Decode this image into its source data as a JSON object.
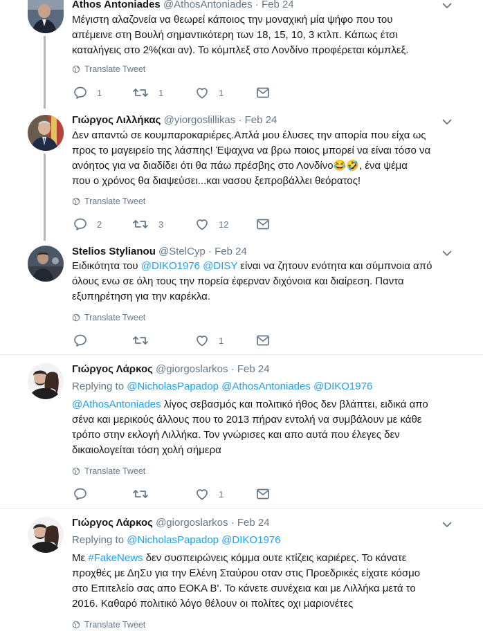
{
  "tweets": [
    {
      "name": "Athos Antoniades",
      "handle": "@AthosAntoniades",
      "date": "Feb 24",
      "text_lines": [
        "Μέγιστη αλαζονεία να θεωρεί κάποιος την μοναχική μία ψήφο που του",
        "απέμεινε στη Βουλή σημαντικότερη των 18, 15, 10, 3 κτλπ. Κάπως έτσι",
        "καταλήγεις στο 2%(και αν). Το κόμπλεξ στο Λονδίνο προφέρεται κόμπλεξ."
      ],
      "translate": "Translate Tweet",
      "replies": "1",
      "retweets": "1",
      "likes": "1"
    },
    {
      "name": "Γιώργος Λιλλήκας",
      "handle": "@yiorgoslillikas",
      "date": "Feb 24",
      "text_lines": [
        "Δεν απαντώ σε κουμπαροκαριέρες.Απλά μου έλυσες την απορία που είχα ως",
        "προς το μαγειρείο της λάσπης! Έψαχνα να βρω ποιος μπορεί να είναι τόσο να",
        "ανόητος για να διαδίδει ότι θα πάω πρέσβης στο Λονδίνο😂🤣, ένα ψέμα",
        "που ο χρόνος θα διαψεύσει...και νασου ξεπροβάλλει θεόρατος!"
      ],
      "translate": "Translate Tweet",
      "replies": "2",
      "retweets": "3",
      "likes": "12"
    },
    {
      "name": "Stelios Stylianou",
      "handle": "@StelCyp",
      "date": "Feb 24",
      "line1_pre": "Ειδικότητα του ",
      "mention1": "@DIKO1976",
      "mention2": "@DISY",
      "line1_post": " είναι να ζητουν ενότητα και σύμπνοια από",
      "line2": "όλους ενω σε όλη τους την πορεία έφερναν διχόνοια και διαίρεση. Παντα",
      "line3": "εξυπηρέτηση για την καρέκλα.",
      "translate": "Translate Tweet",
      "likes": "1"
    },
    {
      "name": "Γιώργος Λάρκος",
      "handle": "@giorgoslarkos",
      "date": "Feb 24",
      "replying_label": "Replying to",
      "replying_mentions": [
        "@NicholasPapadop",
        "@AthosAntoniades",
        "@DIKO1976"
      ],
      "mention": "@AthosAntoniades",
      "line1_post": " λίγος σεβασμός και πολιτικό ήθος δεν βλάπτει, ειδικά απο",
      "line2": "σένα και μερικούς άλλους που το 2013 πήραν εντολή να συμβάλουν με κάθε",
      "line3": "τρόπο στην εκλογή Λιλλήκα. Τον γνώρισες και απο αυτά που έλεγες δεν",
      "line4": "δικαιολογείται τόση χολή σήμερα",
      "translate": "Translate Tweet",
      "likes": "1"
    },
    {
      "name": "Γιώργος Λάρκος",
      "handle": "@giorgoslarkos",
      "date": "Feb 24",
      "replying_label": "Replying to",
      "replying_mentions": [
        "@NicholasPapadop",
        "@DIKO1976"
      ],
      "line1_pre": "Με ",
      "hashtag": "#FakeNews",
      "line1_post": " δεν συσπειρώνεις κόμμα ουτε κτίζεις καριέρες. Το κάνατε",
      "line2": "προχθές με ΔηΣυ για την Ελένη Σταύρου οταν στις Προεδρικές είχατε κόσμο",
      "line3": "στο Επιτελείο σας απο ΕΟΚΑ Β'. Το κάνετε συνέχεια και με Λιλλήκα μετά το",
      "line4": "2016. Καθαρό πολιτικό λόγο θέλουν οι πολίτες οχι μαριονέτες",
      "translate": "Translate Tweet"
    }
  ],
  "colors": {
    "link": "#1da1f2",
    "muted": "#657786",
    "thread": "#aab8c2"
  }
}
